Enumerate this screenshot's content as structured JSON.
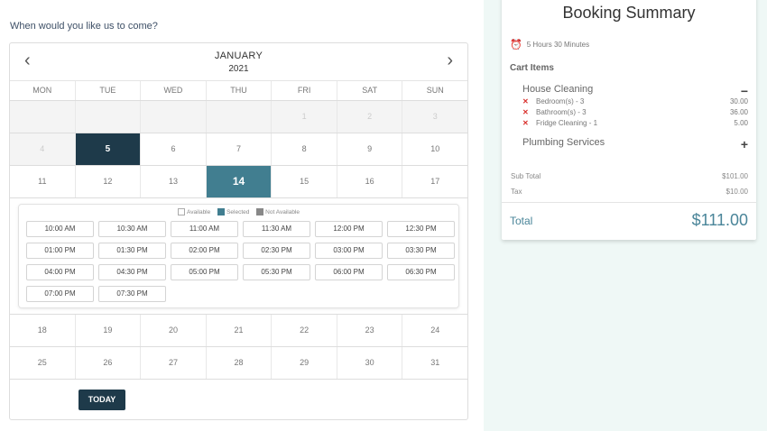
{
  "question": "When would you like us to come?",
  "calendar": {
    "month": "JANUARY",
    "year": "2021",
    "weekdays": [
      "MON",
      "TUE",
      "WED",
      "THU",
      "FRI",
      "SAT",
      "SUN"
    ],
    "weeks_top": [
      [
        {
          "d": "",
          "s": "off"
        },
        {
          "d": "",
          "s": "off"
        },
        {
          "d": "",
          "s": "off"
        },
        {
          "d": "",
          "s": "off"
        },
        {
          "d": "1",
          "s": "off"
        },
        {
          "d": "2",
          "s": "off"
        },
        {
          "d": "3",
          "s": "off"
        }
      ],
      [
        {
          "d": "4",
          "s": "off"
        },
        {
          "d": "5",
          "s": "today"
        },
        {
          "d": "6",
          "s": ""
        },
        {
          "d": "7",
          "s": ""
        },
        {
          "d": "8",
          "s": ""
        },
        {
          "d": "9",
          "s": ""
        },
        {
          "d": "10",
          "s": ""
        }
      ],
      [
        {
          "d": "11",
          "s": ""
        },
        {
          "d": "12",
          "s": ""
        },
        {
          "d": "13",
          "s": ""
        },
        {
          "d": "14",
          "s": "sel"
        },
        {
          "d": "15",
          "s": ""
        },
        {
          "d": "16",
          "s": ""
        },
        {
          "d": "17",
          "s": ""
        }
      ]
    ],
    "weeks_bottom": [
      [
        {
          "d": "18",
          "s": ""
        },
        {
          "d": "19",
          "s": ""
        },
        {
          "d": "20",
          "s": ""
        },
        {
          "d": "21",
          "s": ""
        },
        {
          "d": "22",
          "s": ""
        },
        {
          "d": "23",
          "s": ""
        },
        {
          "d": "24",
          "s": ""
        }
      ],
      [
        {
          "d": "25",
          "s": ""
        },
        {
          "d": "26",
          "s": ""
        },
        {
          "d": "27",
          "s": ""
        },
        {
          "d": "28",
          "s": ""
        },
        {
          "d": "29",
          "s": ""
        },
        {
          "d": "30",
          "s": ""
        },
        {
          "d": "31",
          "s": ""
        }
      ]
    ],
    "legend": {
      "available": "Available",
      "selected": "Selected",
      "not_available": "Not Available"
    },
    "slots": [
      "10:00 AM",
      "10:30 AM",
      "11:00 AM",
      "11:30 AM",
      "12:00 PM",
      "12:30 PM",
      "01:00 PM",
      "01:30 PM",
      "02:00 PM",
      "02:30 PM",
      "03:00 PM",
      "03:30 PM",
      "04:00 PM",
      "04:30 PM",
      "05:00 PM",
      "05:30 PM",
      "06:00 PM",
      "06:30 PM",
      "07:00 PM",
      "07:30 PM"
    ],
    "today_label": "TODAY"
  },
  "summary": {
    "title": "Booking Summary",
    "duration": "5 Hours 30 Minutes",
    "cart_label": "Cart Items",
    "services": [
      {
        "name": "House Cleaning",
        "toggle": "−",
        "items": [
          {
            "name": "Bedroom(s) - 3",
            "price": "30.00"
          },
          {
            "name": "Bathroom(s) - 3",
            "price": "36.00"
          },
          {
            "name": "Fridge Cleaning - 1",
            "price": "5.00"
          }
        ]
      },
      {
        "name": "Plumbing Services",
        "toggle": "+"
      }
    ],
    "subtotal_label": "Sub Total",
    "subtotal": "$101.00",
    "tax_label": "Tax",
    "tax": "$10.00",
    "total_label": "Total",
    "total": "$111.00"
  },
  "colors": {
    "accent": "#417e90",
    "dark": "#1e3a4a",
    "remove": "#d9302c"
  }
}
